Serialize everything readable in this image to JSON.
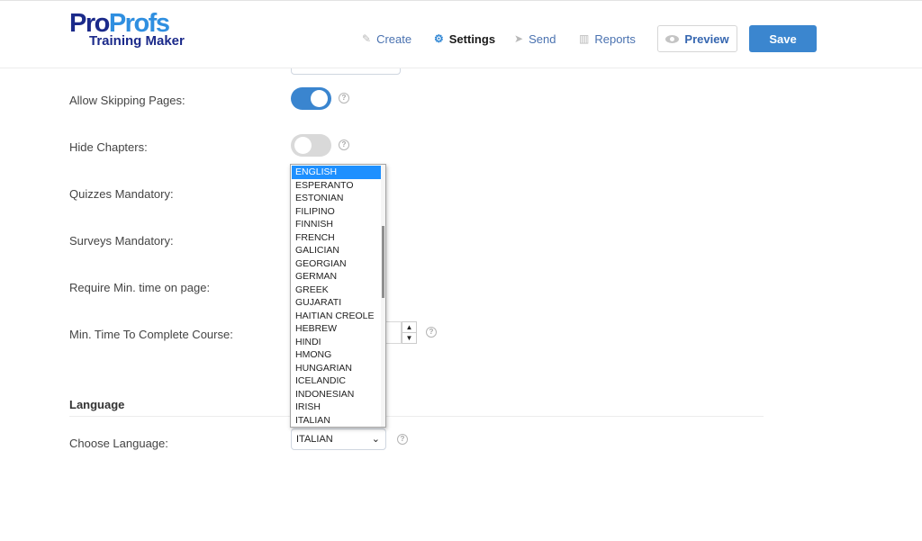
{
  "header": {
    "logo": {
      "part1": "Pro",
      "part2": "Profs",
      "subtitle": "Training Maker"
    },
    "nav": [
      {
        "label": "Create",
        "icon": "pencil-icon",
        "active": false
      },
      {
        "label": "Settings",
        "icon": "gear-icon",
        "active": true
      },
      {
        "label": "Send",
        "icon": "paper-plane-icon",
        "active": false
      },
      {
        "label": "Reports",
        "icon": "bar-chart-icon",
        "active": false
      }
    ],
    "preview_label": "Preview",
    "save_label": "Save"
  },
  "settings": {
    "rows": [
      {
        "label": "Allow Skipping Pages:",
        "type": "toggle",
        "value": true
      },
      {
        "label": "Hide Chapters:",
        "type": "toggle",
        "value": false
      },
      {
        "label": "Quizzes Mandatory:",
        "type": "toggle"
      },
      {
        "label": "Surveys Mandatory:",
        "type": "toggle"
      },
      {
        "label": "Require Min. time on page:",
        "type": "toggle"
      },
      {
        "label": "Min. Time To Complete Course:",
        "type": "number"
      }
    ],
    "help_glyph": "?",
    "spinner_up": "▲",
    "spinner_down": "▼"
  },
  "language": {
    "section_title": "Language",
    "choose_label": "Choose Language:",
    "selected": "ITALIAN",
    "chevron": "⌄",
    "dropdown_highlighted": "ENGLISH",
    "dropdown_options": [
      "ENGLISH",
      "ESPERANTO",
      "ESTONIAN",
      "FILIPINO",
      "FINNISH",
      "FRENCH",
      "GALICIAN",
      "GEORGIAN",
      "GERMAN",
      "GREEK",
      "GUJARATI",
      "HAITIAN CREOLE",
      "HEBREW",
      "HINDI",
      "HMONG",
      "HUNGARIAN",
      "ICELANDIC",
      "INDONESIAN",
      "IRISH",
      "ITALIAN"
    ]
  },
  "colors": {
    "accent": "#3a85cf",
    "logo_dark": "#1b2a8a",
    "logo_light": "#2f8fe0",
    "dropdown_highlight": "#1e90ff"
  }
}
